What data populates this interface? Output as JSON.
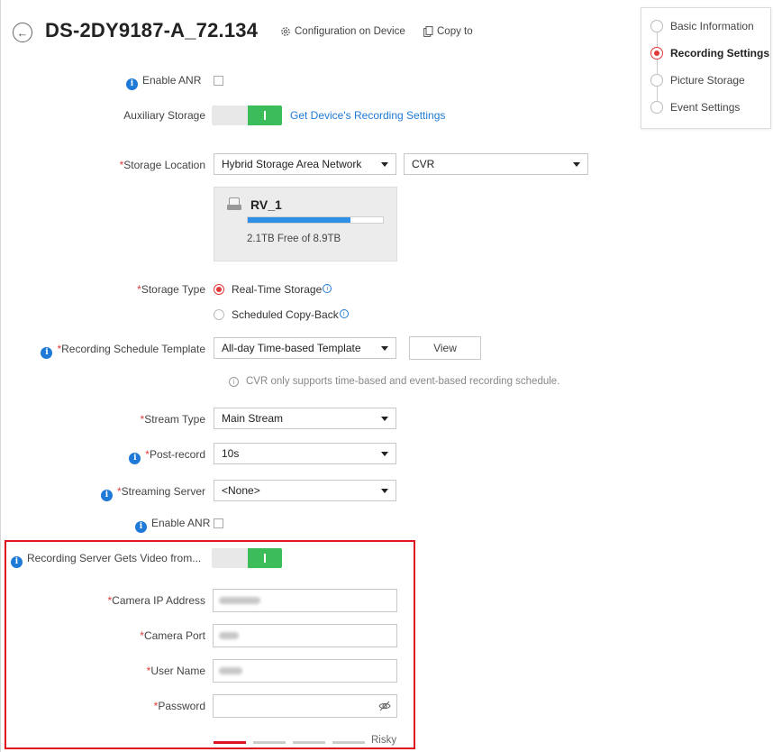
{
  "header": {
    "title": "DS-2DY9187-A_72.134",
    "config_link": "Configuration on Device",
    "copy_link": "Copy to"
  },
  "form": {
    "enable_anr_1": "Enable ANR",
    "aux_storage_label": "Auxiliary Storage",
    "aux_storage_on": true,
    "get_recording_link": "Get Device's Recording Settings",
    "storage_location_label": "Storage Location",
    "storage_location_value": "Hybrid Storage Area Network",
    "storage_target_value": "CVR",
    "storage_card": {
      "name": "RV_1",
      "free_text": "2.1TB Free of 8.9TB",
      "used_fraction": 0.76
    },
    "storage_type_label": "Storage Type",
    "storage_type_options": [
      "Real-Time Storage",
      "Scheduled Copy-Back"
    ],
    "storage_type_selected": "Real-Time Storage",
    "schedule_template_label": "Recording Schedule Template",
    "schedule_template_value": "All-day Time-based Template",
    "view_button": "View",
    "hint": "CVR only supports time-based and event-based recording schedule.",
    "stream_type_label": "Stream Type",
    "stream_type_value": "Main Stream",
    "post_record_label": "Post-record",
    "post_record_value": "10s",
    "streaming_server_label": "Streaming Server",
    "streaming_server_value": "<None>",
    "enable_anr_2": "Enable ANR",
    "recording_server_label": "Recording Server Gets Video from...",
    "recording_server_on": true,
    "camera_ip_label": "Camera IP Address",
    "camera_port_label": "Camera Port",
    "user_name_label": "User Name",
    "password_label": "Password",
    "password_strength": "Risky"
  },
  "nav": {
    "items": [
      "Basic Information",
      "Recording Settings",
      "Picture Storage",
      "Event Settings"
    ],
    "active": "Recording Settings"
  },
  "colors": {
    "accent_blue": "#1e7ad6",
    "toggle_green": "#3dbd59",
    "required_red": "#e23a3a",
    "highlight_red": "#e0141f"
  }
}
